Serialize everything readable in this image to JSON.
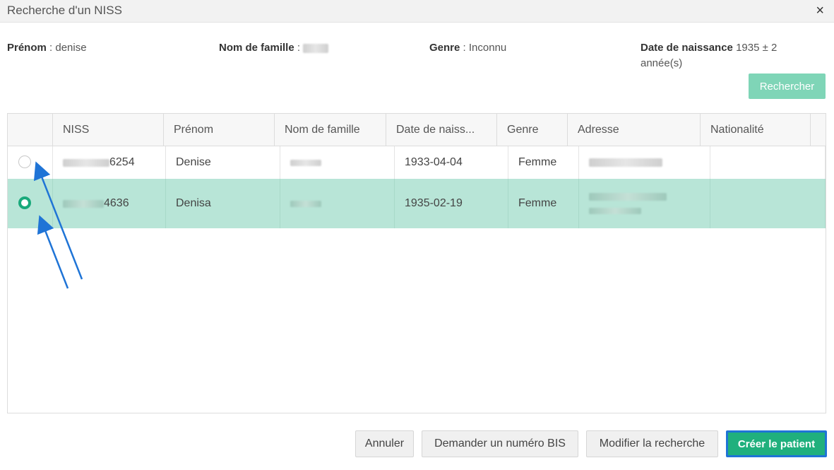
{
  "dialog": {
    "title": "Recherche d'un NISS",
    "close_glyph": "×"
  },
  "criteria": {
    "firstname_label": "Prénom",
    "firstname_value": "denise",
    "lastname_label": "Nom de famille",
    "gender_label": "Genre",
    "gender_value": "Inconnu",
    "birth_label": "Date de naissance",
    "birth_value": "1935 ± 2",
    "birth_unit": "année(s)",
    "separator": " : "
  },
  "search_button": "Rechercher",
  "table": {
    "columns": [
      "NISS",
      "Prénom",
      "Nom de famille",
      "Date de naiss...",
      "Genre",
      "Adresse",
      "Nationalité"
    ],
    "rows": [
      {
        "niss_suffix": "6254",
        "firstname": "Denise",
        "birthdate": "1933-04-04",
        "gender": "Femme",
        "selected": false
      },
      {
        "niss_suffix": "4636",
        "firstname": "Denisa",
        "birthdate": "1935-02-19",
        "gender": "Femme",
        "selected": true
      }
    ]
  },
  "footer": {
    "cancel": "Annuler",
    "bis": "Demander un numéro BIS",
    "modify": "Modifier la recherche",
    "create": "Créer le patient"
  },
  "colors": {
    "accent": "#20b07d",
    "selected_row": "#b8e5d7",
    "annotation_arrow": "#1f74d6"
  }
}
